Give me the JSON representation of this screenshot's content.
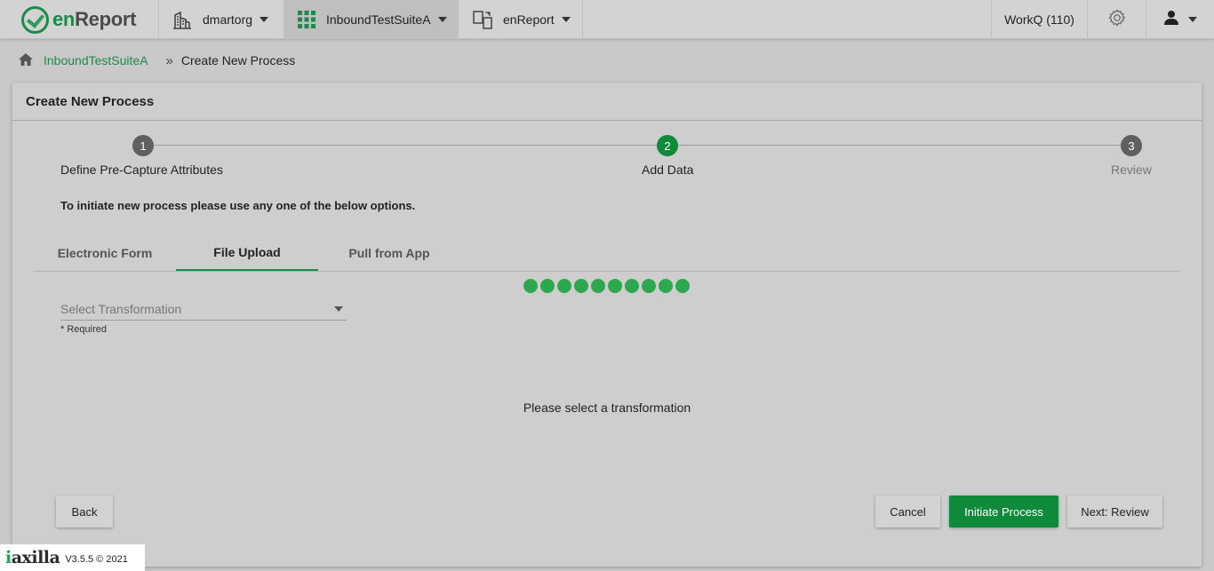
{
  "app": {
    "name_prefix": "en",
    "name_suffix": "Report"
  },
  "topnav": {
    "org": {
      "label": "dmartorg",
      "icon": "building-icon"
    },
    "suite": {
      "label": "InboundTestSuiteA",
      "icon": "grid-icon"
    },
    "app": {
      "label": "enReport",
      "icon": "app-switch-icon"
    },
    "workq": "WorkQ (110)",
    "settings_icon": "gear-icon",
    "user_icon": "user-icon"
  },
  "breadcrumb": {
    "home_icon": "home-icon",
    "link": "InboundTestSuiteA",
    "separator": "»",
    "current": "Create New Process"
  },
  "card": {
    "title": "Create New Process"
  },
  "stepper": {
    "steps": [
      {
        "number": "1",
        "label": "Define Pre-Capture Attributes",
        "state": "completed"
      },
      {
        "number": "2",
        "label": "Add Data",
        "state": "active"
      },
      {
        "number": "3",
        "label": "Review",
        "state": "pending"
      }
    ]
  },
  "instruction": "To initiate new process please use any one of the below options.",
  "tabs": [
    {
      "label": "Electronic Form",
      "active": false
    },
    {
      "label": "File Upload",
      "active": true
    },
    {
      "label": "Pull from App",
      "active": false
    }
  ],
  "loader": {
    "dots": 10
  },
  "transformation_select": {
    "placeholder": "Select Transformation",
    "required_note": "* Required"
  },
  "empty_message": "Please select a transformation",
  "buttons": {
    "back": "Back",
    "cancel": "Cancel",
    "initiate": "Initiate Process",
    "next": "Next: Review"
  },
  "footer": {
    "brand_prefix": "i",
    "brand_suffix": "axilla",
    "version": "V3.5.5 © 2021"
  },
  "colors": {
    "brand_green": "#1c8a4a",
    "primary_button": "#0f8a3a",
    "loader_dot": "#2ea84e",
    "step_inactive": "#5f5f5f"
  }
}
